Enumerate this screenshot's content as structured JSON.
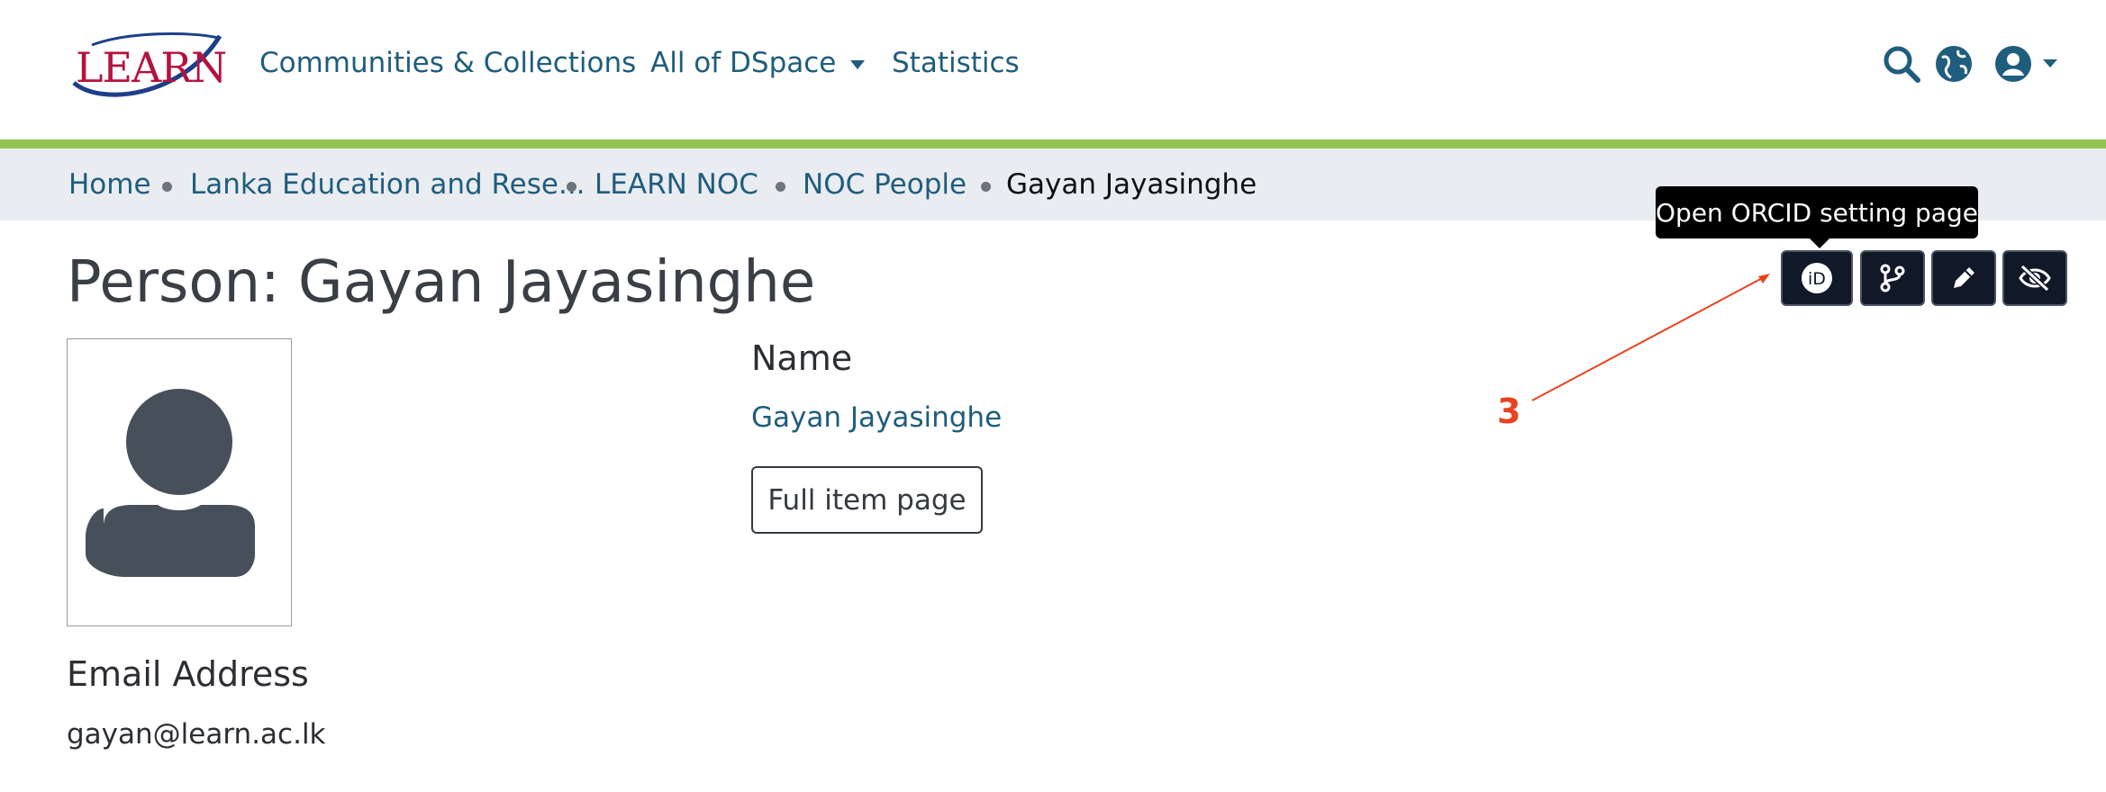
{
  "header": {
    "logo_text": "LEARN",
    "nav": [
      {
        "label": "Communities & Collections"
      },
      {
        "label": "All of DSpace"
      },
      {
        "label": "Statistics"
      }
    ],
    "icons": [
      "search-icon",
      "globe-icon",
      "user-icon"
    ]
  },
  "breadcrumb": [
    {
      "label": "Home"
    },
    {
      "label": "Lanka Education and Rese..."
    },
    {
      "label": "LEARN NOC"
    },
    {
      "label": "NOC People"
    },
    {
      "label": "Gayan Jayasinghe"
    }
  ],
  "page": {
    "title": "Person: Gayan Jayasinghe"
  },
  "actions": {
    "tooltip": "Open ORCID setting page",
    "buttons": [
      "orcid-icon",
      "relationship-icon",
      "edit-icon",
      "hide-icon"
    ]
  },
  "fields": {
    "name_label": "Name",
    "name_value": "Gayan Jayasinghe",
    "full_item_button": "Full item page",
    "email_label": "Email Address",
    "email_value": "gayan@learn.ac.lk"
  },
  "annotation": {
    "number": "3",
    "color": "#e8431e"
  },
  "colors": {
    "link": "#1f5d7d",
    "accent_bar": "#92c353",
    "breadcrumb_bg": "#e9ecf0",
    "button_dark": "#111827"
  }
}
